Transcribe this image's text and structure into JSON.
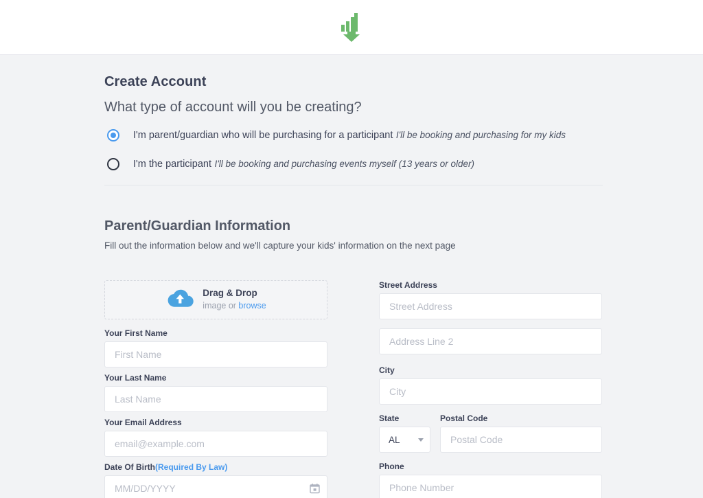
{
  "header": {
    "logo_name": "bar-chart-arrow-logo",
    "logo_color": "#6cb96c"
  },
  "main": {
    "page_title": "Create Account",
    "question": "What type of account will you be creating?",
    "account_types": [
      {
        "id": "parent-guardian",
        "label": "I'm parent/guardian who will be purchasing for a participant",
        "sub": "I'll be booking and purchasing for my kids",
        "selected": true
      },
      {
        "id": "participant",
        "label": "I'm the participant",
        "sub": "I'll be booking and purchasing events myself (13 years or older)",
        "selected": false
      }
    ],
    "section": {
      "title": "Parent/Guardian Information",
      "subtitle": "Fill out the information below and we'll capture your kids' information on the next page"
    },
    "upload": {
      "title": "Drag & Drop",
      "sub_prefix": "image or ",
      "browse_label": "browse",
      "icon": "cloud-upload-icon",
      "icon_color": "#4aa3e0"
    },
    "left_fields": [
      {
        "label": "Your First Name",
        "placeholder": "First Name",
        "value": ""
      },
      {
        "label": "Your Last Name",
        "placeholder": "Last Name",
        "value": ""
      },
      {
        "label": "Your Email Address",
        "placeholder": "email@example.com",
        "value": ""
      }
    ],
    "dob": {
      "label": "Date Of Birth",
      "required_note": "(Required By Law)",
      "placeholder": "MM/DD/YYYY",
      "value": "",
      "icon": "calendar-icon"
    },
    "right_fields": {
      "street_label": "Street Address",
      "street_placeholder": "Street Address",
      "street_value": "",
      "address2_placeholder": "Address Line 2",
      "address2_value": "",
      "city_label": "City",
      "city_placeholder": "City",
      "city_value": "",
      "state_label": "State",
      "state_value": "AL",
      "postal_label": "Postal Code",
      "postal_placeholder": "Postal Code",
      "postal_value": "",
      "phone_label": "Phone",
      "phone_placeholder": "Phone Number",
      "phone_value": ""
    }
  },
  "colors": {
    "accent_blue": "#4a9aee",
    "page_bg": "#f2f3f5",
    "logo_green": "#6cb96c"
  }
}
